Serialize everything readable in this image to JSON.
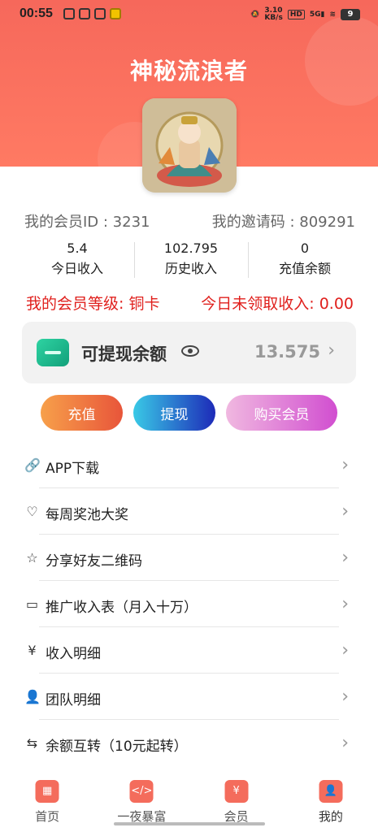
{
  "status_bar": {
    "time": "00:55",
    "net_speed": "3.10\nKB/s",
    "battery": "9"
  },
  "profile": {
    "nickname": "神秘流浪者"
  },
  "ids": {
    "member_id": "我的会员ID : 3231",
    "invite_code": "我的邀请码 : 809291"
  },
  "stats": [
    {
      "value": "5.4",
      "label": "今日收入"
    },
    {
      "value": "102.795",
      "label": "历史收入"
    },
    {
      "value": "0",
      "label": "充值余额"
    }
  ],
  "levels": {
    "member_level": "我的会员等级: 铜卡",
    "unclaimed_today": "今日未领取收入: 0.00"
  },
  "balance": {
    "title": "可提现余额",
    "amount": "13.575"
  },
  "buttons": {
    "recharge": "充值",
    "withdraw": "提现",
    "buy_member": "购买会员"
  },
  "menu": [
    {
      "label": "APP下载",
      "icon": "link-icon"
    },
    {
      "label": "每周奖池大奖",
      "icon": "heart-icon"
    },
    {
      "label": "分享好友二维码",
      "icon": "star-icon"
    },
    {
      "label": "推广收入表（月入十万）",
      "icon": "ticket-icon"
    },
    {
      "label": "收入明细",
      "icon": "yen-icon"
    },
    {
      "label": "团队明细",
      "icon": "user-icon"
    },
    {
      "label": "余额互转（10元起转）",
      "icon": "transfer-icon"
    }
  ],
  "nav": [
    {
      "label": "首页",
      "icon": "home-icon"
    },
    {
      "label": "一夜暴富",
      "icon": "code-icon"
    },
    {
      "label": "会员",
      "icon": "member-icon"
    },
    {
      "label": "我的",
      "icon": "profile-icon"
    }
  ],
  "colors": {
    "primary": "#f46c5c",
    "alert_red": "#e0201d",
    "wallet_green": "#12a07a"
  }
}
